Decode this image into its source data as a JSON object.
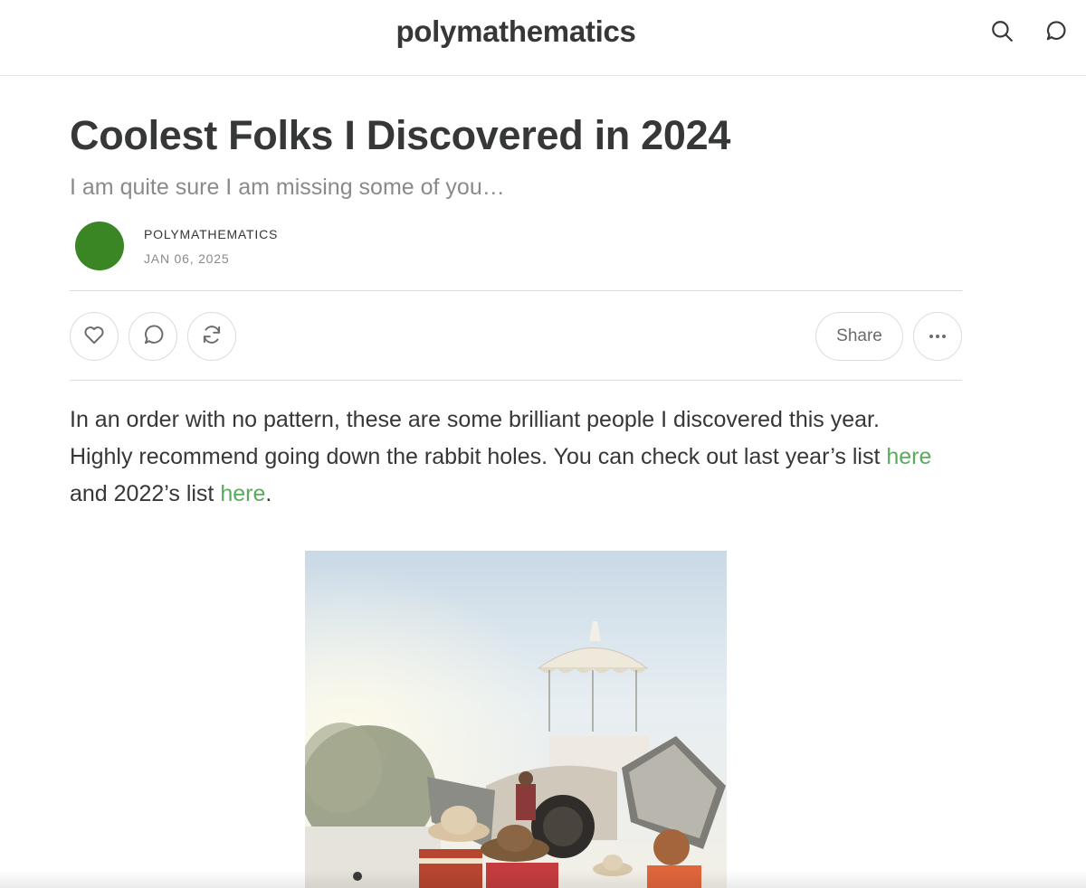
{
  "header": {
    "publication_name": "polymathematics",
    "icons": [
      "search-icon",
      "chat-icon"
    ]
  },
  "post": {
    "title": "Coolest Folks I Discovered in 2024",
    "subtitle": "I am quite sure I am missing some of you…",
    "author": "POLYMATHEMATICS",
    "date": "JAN 06, 2025",
    "avatar_color": "#3a8524"
  },
  "actions": {
    "icons": [
      "heart-icon",
      "comment-icon",
      "restack-icon",
      "more-icon"
    ],
    "share_label": "Share"
  },
  "body": {
    "intro_1": "In an order with no pattern, these are some brilliant people I discovered this year.",
    "intro_2": "Highly recommend going down the rabbit holes. You can check out last year’s list ",
    "link_1": "here",
    "intro_3": "and 2022’s list ",
    "link_2": "here",
    "intro_end": "."
  },
  "colors": {
    "text": "#363737",
    "muted": "#8a8a8a",
    "link": "#5bab5e",
    "divider": "#dcdcdc"
  }
}
